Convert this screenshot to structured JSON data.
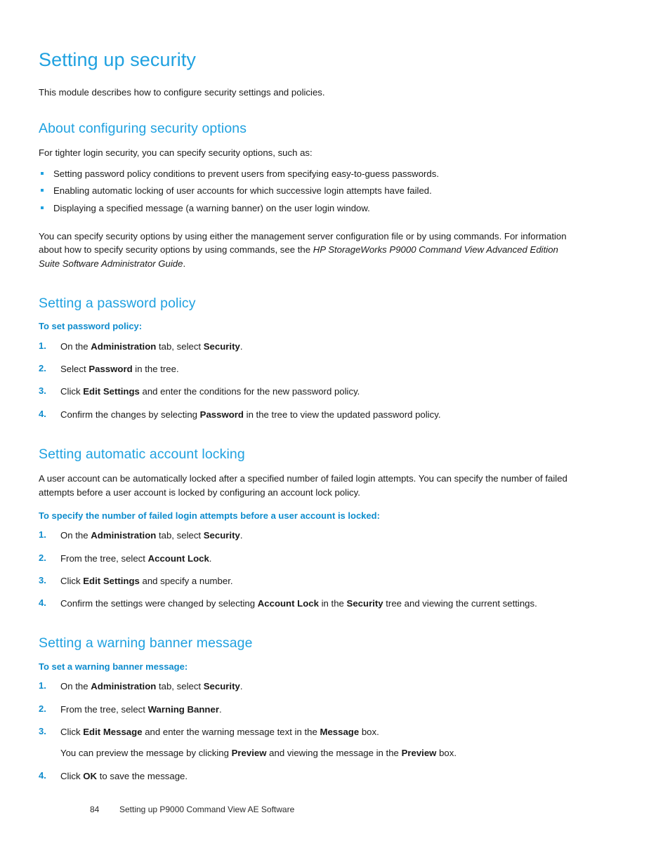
{
  "page": {
    "number": "84",
    "footer_text": "Setting up P9000 Command View AE Software",
    "colors": {
      "heading_blue": "#1fa1e0",
      "subheading_blue": "#0e8ccd",
      "body_text": "#1a1a1a",
      "background": "#ffffff"
    }
  },
  "chapter": {
    "title": "Setting up security",
    "intro": "This module describes how to configure security settings and policies."
  },
  "sections": [
    {
      "title": "About configuring security options",
      "lead": "For tighter login security, you can specify security options, such as:",
      "bullets": [
        "Setting password policy conditions to prevent users from specifying easy-to-guess passwords.",
        "Enabling automatic locking of user accounts for which successive login attempts have failed.",
        "Displaying a specified message (a warning banner) on the user login window."
      ],
      "closing_plain_1": "You can specify security options by using either the management server configuration file or by using commands. For information about how to specify security options by using commands, see the ",
      "closing_italic": "HP StorageWorks P9000 Command View Advanced Edition Suite Software Administrator Guide",
      "closing_plain_2": "."
    },
    {
      "title": "Setting a password policy",
      "procedure_title": "To set password policy:",
      "steps": [
        {
          "num": "1.",
          "parts": [
            {
              "text": "On the ",
              "bold": false
            },
            {
              "text": "Administration",
              "bold": true
            },
            {
              "text": " tab, select ",
              "bold": false
            },
            {
              "text": "Security",
              "bold": true
            },
            {
              "text": ".",
              "bold": false
            }
          ]
        },
        {
          "num": "2.",
          "parts": [
            {
              "text": "Select ",
              "bold": false
            },
            {
              "text": "Password",
              "bold": true
            },
            {
              "text": " in the tree.",
              "bold": false
            }
          ]
        },
        {
          "num": "3.",
          "parts": [
            {
              "text": "Click ",
              "bold": false
            },
            {
              "text": "Edit Settings",
              "bold": true
            },
            {
              "text": " and enter the conditions for the new password policy.",
              "bold": false
            }
          ]
        },
        {
          "num": "4.",
          "parts": [
            {
              "text": "Confirm the changes by selecting ",
              "bold": false
            },
            {
              "text": "Password",
              "bold": true
            },
            {
              "text": " in the tree to view the updated password policy.",
              "bold": false
            }
          ]
        }
      ]
    },
    {
      "title": "Setting automatic account locking",
      "lead": "A user account can be automatically locked after a specified number of failed login attempts. You can specify the number of failed attempts before a user account is locked by configuring an account lock policy.",
      "procedure_title": "To specify the number of failed login attempts before a user account is locked:",
      "steps": [
        {
          "num": "1.",
          "parts": [
            {
              "text": "On the ",
              "bold": false
            },
            {
              "text": "Administration",
              "bold": true
            },
            {
              "text": " tab, select ",
              "bold": false
            },
            {
              "text": "Security",
              "bold": true
            },
            {
              "text": ".",
              "bold": false
            }
          ]
        },
        {
          "num": "2.",
          "parts": [
            {
              "text": "From the tree, select ",
              "bold": false
            },
            {
              "text": "Account Lock",
              "bold": true
            },
            {
              "text": ".",
              "bold": false
            }
          ]
        },
        {
          "num": "3.",
          "parts": [
            {
              "text": "Click ",
              "bold": false
            },
            {
              "text": "Edit Settings",
              "bold": true
            },
            {
              "text": " and specify a number.",
              "bold": false
            }
          ]
        },
        {
          "num": "4.",
          "parts": [
            {
              "text": "Confirm the settings were changed by selecting ",
              "bold": false
            },
            {
              "text": "Account Lock",
              "bold": true
            },
            {
              "text": " in the ",
              "bold": false
            },
            {
              "text": "Security",
              "bold": true
            },
            {
              "text": " tree and viewing the current settings.",
              "bold": false
            }
          ]
        }
      ]
    },
    {
      "title": "Setting a warning banner message",
      "procedure_title": "To set a warning banner message:",
      "steps": [
        {
          "num": "1.",
          "parts": [
            {
              "text": "On the ",
              "bold": false
            },
            {
              "text": "Administration",
              "bold": true
            },
            {
              "text": " tab, select ",
              "bold": false
            },
            {
              "text": "Security",
              "bold": true
            },
            {
              "text": ".",
              "bold": false
            }
          ]
        },
        {
          "num": "2.",
          "parts": [
            {
              "text": "From the tree, select ",
              "bold": false
            },
            {
              "text": "Warning Banner",
              "bold": true
            },
            {
              "text": ".",
              "bold": false
            }
          ]
        },
        {
          "num": "3.",
          "parts": [
            {
              "text": "Click ",
              "bold": false
            },
            {
              "text": "Edit Message",
              "bold": true
            },
            {
              "text": " and enter the warning message text in the ",
              "bold": false
            },
            {
              "text": "Message",
              "bold": true
            },
            {
              "text": " box.",
              "bold": false
            }
          ],
          "substep_parts": [
            {
              "text": "You can preview the message by clicking ",
              "bold": false
            },
            {
              "text": "Preview",
              "bold": true
            },
            {
              "text": " and viewing the message in the ",
              "bold": false
            },
            {
              "text": "Preview",
              "bold": true
            },
            {
              "text": " box.",
              "bold": false
            }
          ]
        },
        {
          "num": "4.",
          "parts": [
            {
              "text": "Click ",
              "bold": false
            },
            {
              "text": "OK",
              "bold": true
            },
            {
              "text": " to save the message.",
              "bold": false
            }
          ]
        }
      ]
    }
  ]
}
